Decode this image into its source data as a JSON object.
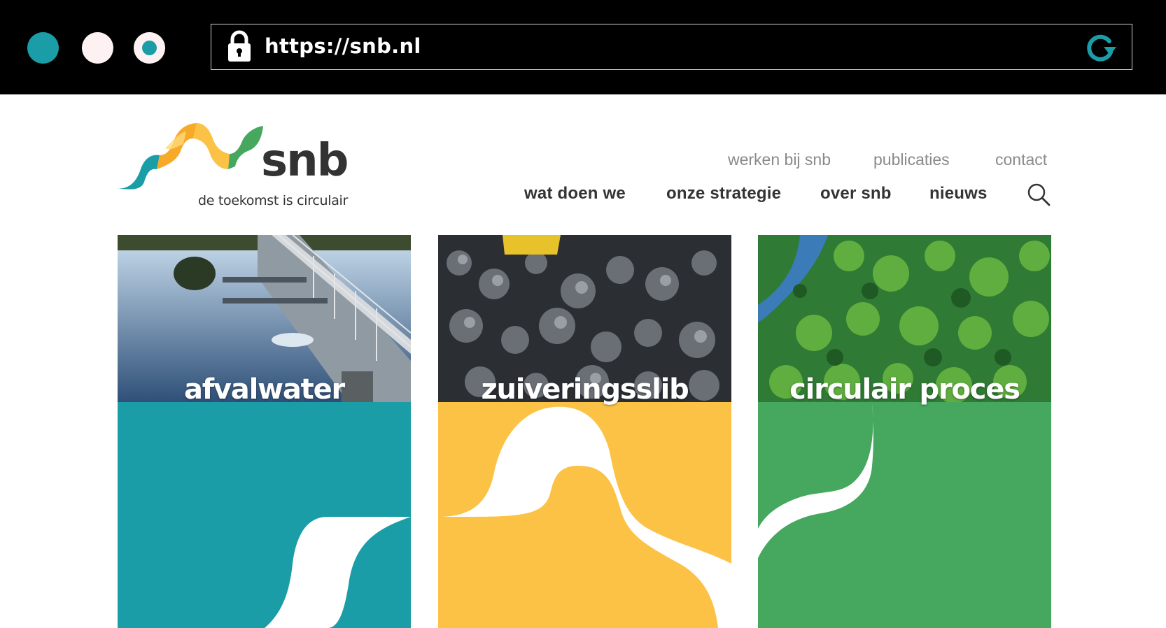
{
  "browser": {
    "url": "https://snb.nl",
    "window_dots": [
      "teal",
      "white",
      "teal-ring"
    ],
    "icons": {
      "lock": "lock-icon",
      "reload": "reload-icon"
    },
    "accent": "#1a9da6"
  },
  "site": {
    "logo": {
      "word": "snb",
      "tagline": "de toekomst is circulair"
    },
    "top_nav": [
      "werken bij snb",
      "publicaties",
      "contact"
    ],
    "main_nav": [
      "wat doen we",
      "onze strategie",
      "over snb",
      "nieuws"
    ],
    "search_icon": "search-icon"
  },
  "cards": [
    {
      "label": "afvalwater",
      "color": "#1a9da6"
    },
    {
      "label": "zuiveringsslib",
      "color": "#fcc245"
    },
    {
      "label": "circulair proces",
      "color": "#45a85e"
    }
  ]
}
